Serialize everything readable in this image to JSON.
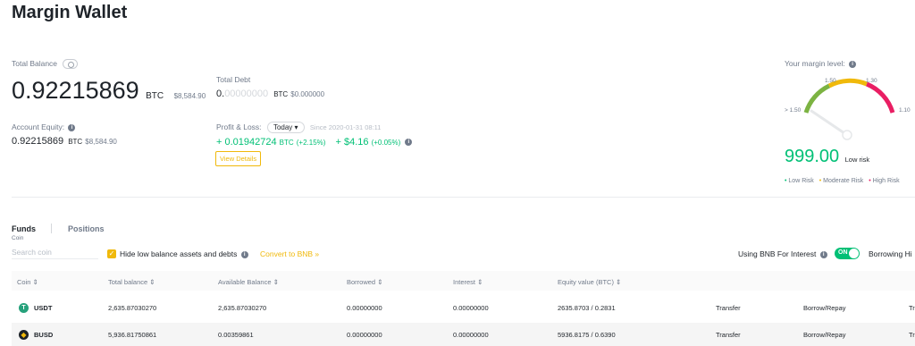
{
  "page_title": "Margin Wallet",
  "balance": {
    "total_label": "Total Balance",
    "total_value": "0.92215869",
    "total_unit": "BTC",
    "total_usd": "$8,584.90",
    "debt_label": "Total Debt",
    "debt_value_main": "0.",
    "debt_value_faint": "00000000",
    "debt_unit": "BTC",
    "debt_usd": "$0.000000",
    "equity_label": "Account Equity:",
    "equity_value": "0.92215869",
    "equity_unit": "BTC",
    "equity_usd": "$8,584.90",
    "pl_label": "Profit & Loss:",
    "pl_period": "Today",
    "pl_since": "Since 2020-01-31 08:11",
    "pl_btc": "+ 0.01942724",
    "pl_btc_unit": "BTC",
    "pl_btc_pct": "(+2.15%)",
    "pl_usd": "+ $4.16",
    "pl_usd_pct": "(+0.05%)",
    "view_details": "View Details"
  },
  "margin_level": {
    "label": "Your margin level:",
    "value": "999.00",
    "risk": "Low risk",
    "ticks": [
      "> 1.50",
      "1.50",
      "1.30",
      "1.10"
    ],
    "legend": [
      "Low Risk",
      "Moderate Risk",
      "High Risk"
    ],
    "colors": {
      "low": "#7cb342",
      "moderate": "#f0b90b",
      "high": "#e91e63"
    }
  },
  "tabs": {
    "funds": "Funds",
    "positions": "Positions",
    "coin_label": "Coin"
  },
  "controls": {
    "search_placeholder": "Search coin",
    "hide_low_balance": "Hide low balance assets and debts",
    "convert_bnb": "Convert to BNB »",
    "bnb_interest": "Using BNB For Interest",
    "toggle_state": "ON",
    "borrowing_history": "Borrowing Hi"
  },
  "table": {
    "headers": [
      "Coin",
      "Total balance",
      "Available Balance",
      "Borrowed",
      "Interest",
      "Equity value (BTC)"
    ],
    "rows": [
      {
        "coin": "USDT",
        "total": "2,635.87030270",
        "available": "2,635.87030270",
        "borrowed": "0.00000000",
        "interest": "0.00000000",
        "equity": "2635.8703 / 0.2831",
        "transfer": "Transfer",
        "borrow": "Borrow/Repay",
        "trade": "Tr",
        "icon_color": "#26a17b"
      },
      {
        "coin": "BUSD",
        "total": "5,936.81750861",
        "available": "0.00359861",
        "borrowed": "0.00000000",
        "interest": "0.00000000",
        "equity": "5936.8175 / 0.6390",
        "transfer": "Transfer",
        "borrow": "Borrow/Repay",
        "trade": "Tr",
        "icon_color": "#1e2329"
      }
    ]
  }
}
